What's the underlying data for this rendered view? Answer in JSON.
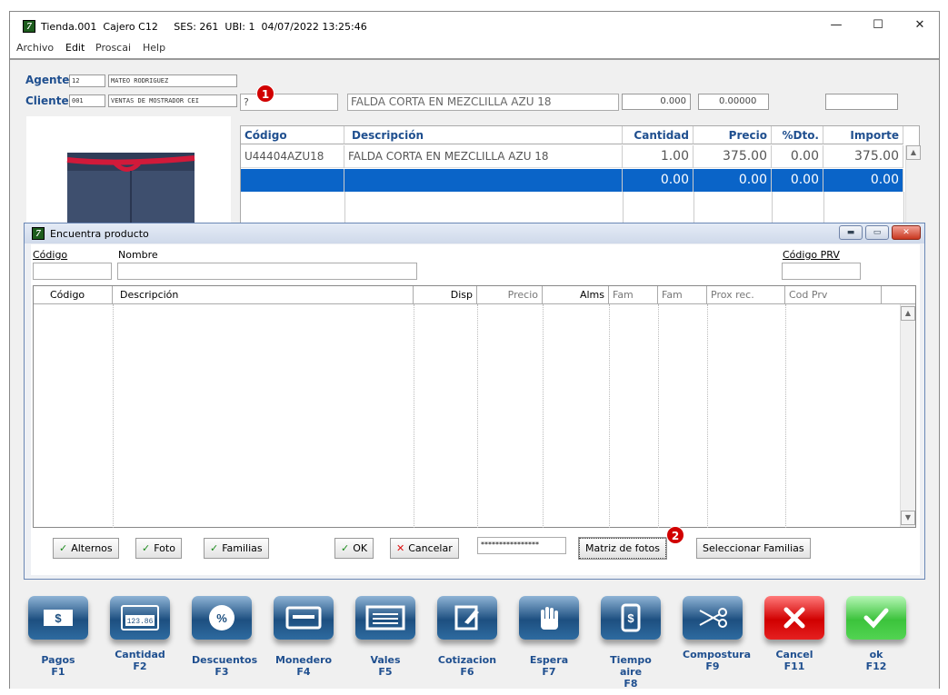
{
  "window": {
    "logo": "7",
    "title": "Tienda.001  Cajero C12     SES: 261  UBI: 1  04/07/2022 13:25:46",
    "min_label": "—",
    "max_label": "☐",
    "close_label": "✕"
  },
  "menu": [
    "Archivo",
    "Edit",
    "Proscai",
    "Help"
  ],
  "agente": {
    "label": "Agente",
    "code": "12",
    "name": "MATEO RODRIGUEZ"
  },
  "cliente": {
    "label": "Cliente",
    "code": "001",
    "name": "VENTAS DE MOSTRADOR CEI"
  },
  "entry": {
    "code": "?",
    "description": "FALDA CORTA EN MEZCLILLA AZU 18",
    "qty": "0.000",
    "price": "0.00000",
    "extra": ""
  },
  "badges": {
    "one": "1",
    "two": "2"
  },
  "grid": {
    "headers": [
      "Código",
      "Descripción",
      "Cantidad",
      "Precio",
      "%Dto.",
      "Importe"
    ],
    "rows": [
      [
        "U44404AZU18",
        "FALDA CORTA EN MEZCLILLA AZU 18",
        "1.00",
        "375.00",
        "0.00",
        "375.00"
      ],
      [
        "",
        "",
        "0.00",
        "0.00",
        "0.00",
        "0.00"
      ]
    ]
  },
  "dialog": {
    "logo": "7",
    "title": "Encuentra producto",
    "codigo_label": "Código",
    "nombre_label": "Nombre",
    "codigo_prv_label": "Código PRV",
    "codigo_value": "",
    "nombre_value": "",
    "codigo_prv_value": "",
    "columns": [
      "Código",
      "Descripción",
      "Disp",
      "Precio",
      "Alms",
      "Fam",
      "Fam",
      "Prox rec.",
      "Cod Prv"
    ],
    "buttons": {
      "alternos": "Alternos",
      "foto": "Foto",
      "familias": "Familias",
      "ok": "OK",
      "cancelar": "Cancelar",
      "password": "****************",
      "matriz": "Matriz de fotos",
      "seleccionar": "Seleccionar Familias"
    }
  },
  "fkeys": [
    {
      "label": "Pagos",
      "key": "F1",
      "icon": "cash-icon",
      "color": "blue"
    },
    {
      "label": "Cantidad",
      "key": "F2",
      "icon": "counter-icon",
      "color": "blue"
    },
    {
      "label": "Descuentos",
      "key": "F3",
      "icon": "percent-icon",
      "color": "blue"
    },
    {
      "label": "Monedero",
      "key": "F4",
      "icon": "card-icon",
      "color": "blue"
    },
    {
      "label": "Vales",
      "key": "F5",
      "icon": "voucher-icon",
      "color": "blue"
    },
    {
      "label": "Cotizacion",
      "key": "F6",
      "icon": "note-icon",
      "color": "blue"
    },
    {
      "label": "Espera",
      "key": "F7",
      "icon": "hand-icon",
      "color": "blue"
    },
    {
      "label": "Tiempo aire",
      "key": "F8",
      "icon": "phone-icon",
      "color": "blue"
    },
    {
      "label": "Compostura",
      "key": "F9",
      "icon": "scissors-icon",
      "color": "blue"
    },
    {
      "label": "Cancel",
      "key": "F11",
      "icon": "x-icon",
      "color": "#d10000"
    },
    {
      "label": "ok",
      "key": "F12",
      "icon": "check-icon",
      "color": "#3cc33c"
    }
  ],
  "icon_glyphs": {
    "pct": "%",
    "cnt": "123.86"
  }
}
